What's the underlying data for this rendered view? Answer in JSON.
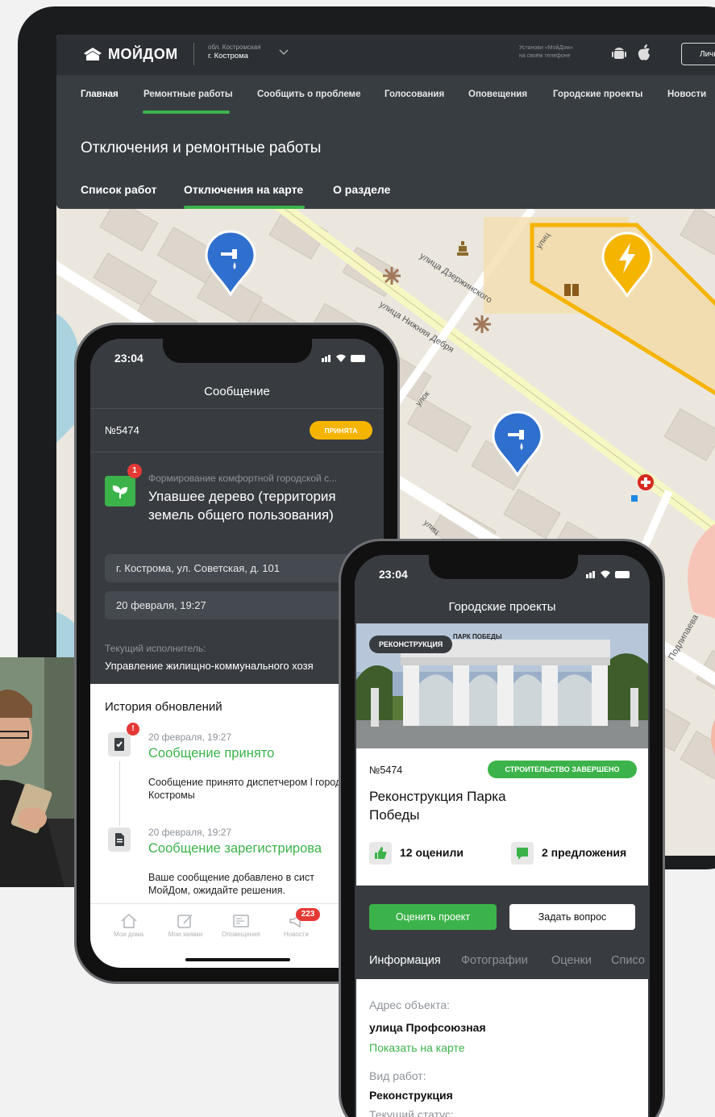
{
  "site": {
    "logo": "МОЙДОМ",
    "region": "обл. Костромская",
    "city": "г. Кострома",
    "install_line1": "Установи «МойДом»",
    "install_line2": "на своём телефоне",
    "cabinet_button": "Личный"
  },
  "nav": {
    "items": [
      "Главная",
      "Ремонтные работы",
      "Сообщить о проблеме",
      "Голосования",
      "Оповещения",
      "Городские проекты",
      "Новости"
    ]
  },
  "section": {
    "title": "Отключения и ремонтные работы",
    "tabs": [
      "Список работ",
      "Отключения на карте",
      "О разделе"
    ]
  },
  "map": {
    "streets": [
      "улица Дзержинского",
      "улица Нижняя Дебря",
      "улок",
      "улиц",
      "Подлипаева",
      "улиц"
    ]
  },
  "phone1": {
    "time": "23:04",
    "title": "Сообщение",
    "number": "№5474",
    "status": "ПРИНЯТА",
    "category": "Формирование комфортной городской с...",
    "badge": "1",
    "subject": "Упавшее дерево (территория земель общего пользования)",
    "address": "г. Кострома, ул. Советская, д. 101",
    "date": "20 февраля, 19:27",
    "executor_label": "Текущий исполнитель:",
    "executor": "Управление жилищно-коммунального хозя",
    "history_title": "История обновлений",
    "history": [
      {
        "date": "20 февраля, 19:27",
        "title": "Сообщение принято",
        "text": "Сообщение принято диспетчером l города Костромы",
        "badge": "!"
      },
      {
        "date": "20 февраля, 19:27",
        "title": "Сообщение зарегистрирова",
        "text": "Ваше сообщение добавлено в сист МойДом, ожидайте решения."
      }
    ],
    "tabbar": [
      "Мои дома",
      "Мои заявки",
      "Оповещения",
      "Новости"
    ],
    "news_badge": "223"
  },
  "phone2": {
    "time": "23:04",
    "title": "Городские проекты",
    "photo_tag": "РЕКОНСТРУКЦИЯ",
    "arch_sign": "ПАРК ПОБЕДЫ",
    "number": "№5474",
    "status": "СТРОИТЕЛЬСТВО ЗАВЕРШЕНО",
    "project": "Реконструкция Парка Победы",
    "ratings": "12 оценили",
    "proposals": "2 предложения",
    "rate_button": "Оценить проект",
    "ask_button": "Задать вопрос",
    "tabs": [
      "Информация",
      "Фотографии",
      "Оценки",
      "Списо"
    ],
    "address_label": "Адрес объекта:",
    "address": "улица Профсоюзная",
    "show_on_map": "Показать на карте",
    "work_type_label": "Вид работ:",
    "work_type": "Реконструкция",
    "status_label": "Текущий статус:"
  },
  "colors": {
    "accent": "#3cb34a",
    "warning": "#f5b400",
    "map_pin": "#2f6fce",
    "alert": "#e53935"
  }
}
